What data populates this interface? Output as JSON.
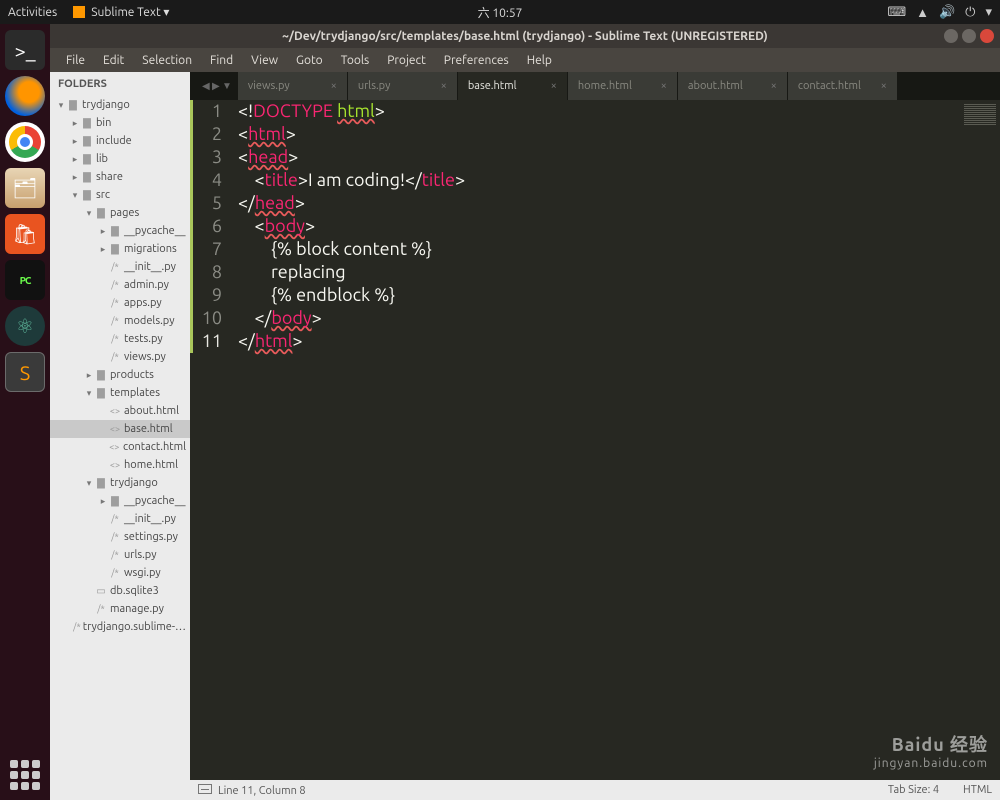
{
  "gnome": {
    "activities": "Activities",
    "app_indicator": "Sublime Text ▾",
    "clock": "六 10:57"
  },
  "window": {
    "title": "~/Dev/trydjango/src/templates/base.html (trydjango) - Sublime Text (UNREGISTERED)"
  },
  "menu": [
    "File",
    "Edit",
    "Selection",
    "Find",
    "View",
    "Goto",
    "Tools",
    "Project",
    "Preferences",
    "Help"
  ],
  "sidebar": {
    "header": "FOLDERS",
    "tree": [
      {
        "d": 0,
        "a": "▾",
        "i": "folder",
        "t": "trydjango"
      },
      {
        "d": 1,
        "a": "▸",
        "i": "folder",
        "t": "bin"
      },
      {
        "d": 1,
        "a": "▸",
        "i": "folder",
        "t": "include"
      },
      {
        "d": 1,
        "a": "▸",
        "i": "folder",
        "t": "lib"
      },
      {
        "d": 1,
        "a": "▸",
        "i": "folder",
        "t": "share"
      },
      {
        "d": 1,
        "a": "▾",
        "i": "folder",
        "t": "src"
      },
      {
        "d": 2,
        "a": "▾",
        "i": "folder",
        "t": "pages"
      },
      {
        "d": 3,
        "a": "▸",
        "i": "folder",
        "t": "__pycache__"
      },
      {
        "d": 3,
        "a": "▸",
        "i": "folder",
        "t": "migrations"
      },
      {
        "d": 3,
        "a": "",
        "i": "py",
        "t": "__init__.py"
      },
      {
        "d": 3,
        "a": "",
        "i": "py",
        "t": "admin.py"
      },
      {
        "d": 3,
        "a": "",
        "i": "py",
        "t": "apps.py"
      },
      {
        "d": 3,
        "a": "",
        "i": "py",
        "t": "models.py"
      },
      {
        "d": 3,
        "a": "",
        "i": "py",
        "t": "tests.py"
      },
      {
        "d": 3,
        "a": "",
        "i": "py",
        "t": "views.py"
      },
      {
        "d": 2,
        "a": "▸",
        "i": "folder",
        "t": "products"
      },
      {
        "d": 2,
        "a": "▾",
        "i": "folder",
        "t": "templates"
      },
      {
        "d": 3,
        "a": "",
        "i": "html",
        "t": "about.html"
      },
      {
        "d": 3,
        "a": "",
        "i": "html",
        "t": "base.html",
        "sel": true
      },
      {
        "d": 3,
        "a": "",
        "i": "html",
        "t": "contact.html"
      },
      {
        "d": 3,
        "a": "",
        "i": "html",
        "t": "home.html"
      },
      {
        "d": 2,
        "a": "▾",
        "i": "folder",
        "t": "trydjango"
      },
      {
        "d": 3,
        "a": "▸",
        "i": "folder",
        "t": "__pycache__"
      },
      {
        "d": 3,
        "a": "",
        "i": "py",
        "t": "__init__.py"
      },
      {
        "d": 3,
        "a": "",
        "i": "py",
        "t": "settings.py"
      },
      {
        "d": 3,
        "a": "",
        "i": "py",
        "t": "urls.py"
      },
      {
        "d": 3,
        "a": "",
        "i": "py",
        "t": "wsgi.py"
      },
      {
        "d": 2,
        "a": "",
        "i": "db",
        "t": "db.sqlite3"
      },
      {
        "d": 2,
        "a": "",
        "i": "py",
        "t": "manage.py"
      },
      {
        "d": 1,
        "a": "",
        "i": "py",
        "t": "trydjango.sublime-…"
      }
    ]
  },
  "tabs": [
    {
      "label": "views.py",
      "active": false
    },
    {
      "label": "urls.py",
      "active": false
    },
    {
      "label": "base.html",
      "active": true
    },
    {
      "label": "home.html",
      "active": false
    },
    {
      "label": "about.html",
      "active": false
    },
    {
      "label": "contact.html",
      "active": false
    }
  ],
  "code": {
    "lines": 11,
    "current": 11,
    "content": [
      {
        "tokens": [
          [
            "punct",
            "<!"
          ],
          [
            "tag",
            "DOCTYPE"
          ],
          [
            "txt",
            " "
          ],
          [
            "attr err",
            "html"
          ],
          [
            "punct",
            ">"
          ]
        ]
      },
      {
        "tokens": [
          [
            "punct",
            "<"
          ],
          [
            "tag err",
            "html"
          ],
          [
            "punct",
            ">"
          ]
        ]
      },
      {
        "tokens": [
          [
            "punct",
            "<"
          ],
          [
            "tag err",
            "head"
          ],
          [
            "punct",
            ">"
          ]
        ]
      },
      {
        "indent": 1,
        "tokens": [
          [
            "punct",
            "<"
          ],
          [
            "tag",
            "title"
          ],
          [
            "punct",
            ">"
          ],
          [
            "txt",
            "I am coding!"
          ],
          [
            "punct",
            "</"
          ],
          [
            "tag",
            "title"
          ],
          [
            "punct",
            ">"
          ]
        ]
      },
      {
        "tokens": [
          [
            "punct",
            "</"
          ],
          [
            "tag err",
            "head"
          ],
          [
            "punct",
            ">"
          ]
        ]
      },
      {
        "indent": 1,
        "tokens": [
          [
            "punct",
            "<"
          ],
          [
            "tag err",
            "body"
          ],
          [
            "punct",
            ">"
          ]
        ]
      },
      {
        "indent": 2,
        "tokens": [
          [
            "django",
            "{% block content %}"
          ]
        ]
      },
      {
        "indent": 2,
        "tokens": [
          [
            "txt",
            "replacing"
          ]
        ]
      },
      {
        "indent": 2,
        "tokens": [
          [
            "django",
            "{% endblock %}"
          ]
        ]
      },
      {
        "indent": 1,
        "tokens": [
          [
            "punct",
            "</"
          ],
          [
            "tag err",
            "body"
          ],
          [
            "punct",
            ">"
          ]
        ]
      },
      {
        "tokens": [
          [
            "punct",
            "</"
          ],
          [
            "tag err",
            "html"
          ],
          [
            "punct",
            ">"
          ]
        ]
      }
    ]
  },
  "status": {
    "left": "Line 11, Column 8",
    "tabsize": "Tab Size: 4",
    "syntax": "HTML"
  },
  "watermark": {
    "brand": "Baidu 经验",
    "url": "jingyan.baidu.com"
  }
}
